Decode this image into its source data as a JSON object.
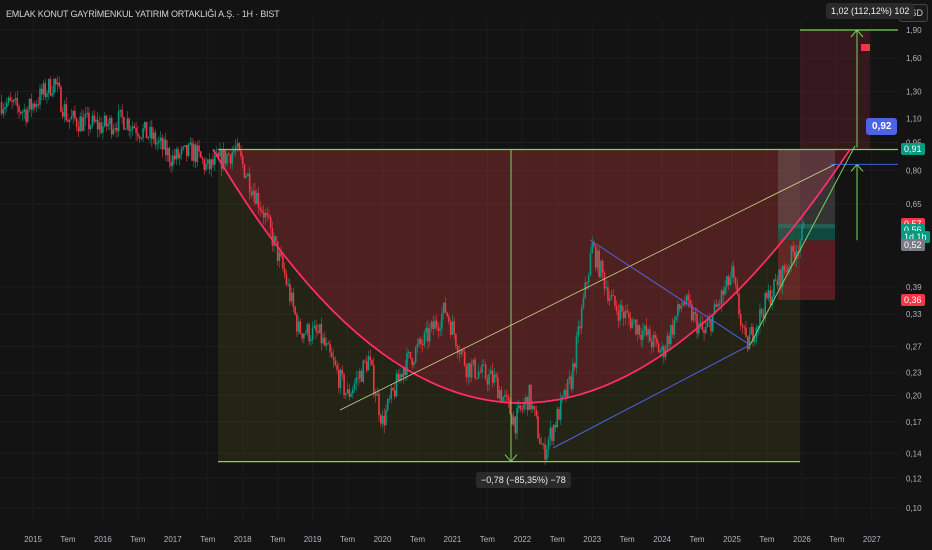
{
  "header": {
    "title": "EMLAK KONUT GAYRİMENKUL YATIRIM ORTAKLIĞI A.Ş. · 1H · BIST",
    "currency_button": "USD"
  },
  "annotations": {
    "measure_top": "1,02 (112,12%) 102",
    "measure_bottom": "−0,78 (−85,35%) −78",
    "target_callout": "0,92"
  },
  "price_labels": [
    {
      "text": "0,91",
      "color": "#089981",
      "price": 0.91
    },
    {
      "text": "0,57",
      "color": "#f23645",
      "price": 0.575
    },
    {
      "text": "0,56",
      "color": "#089981",
      "price": 0.555
    },
    {
      "text": "1d 1h",
      "color": "#089981",
      "price": 0.53
    },
    {
      "text": "0,52",
      "color": "#787b86",
      "price": 0.505
    },
    {
      "text": "0,36",
      "color": "#f23645",
      "price": 0.36
    }
  ],
  "chart_data": {
    "type": "candlestick",
    "title": "EMLAK KONUT GAYRİMENKUL YATIRIM ORTAKLIĞI A.Ş. · 1H · BIST",
    "yscale": "log",
    "ylim": [
      0.095,
      1.95
    ],
    "y_ticks": [
      "1,90",
      "1,60",
      "1,30",
      "1,10",
      "0,95",
      "0,80",
      "0,65",
      "0,39",
      "0,33",
      "0,27",
      "0,23",
      "0,20",
      "0,17",
      "0,14",
      "0,12",
      "0,10"
    ],
    "y_tick_values": [
      1.9,
      1.6,
      1.3,
      1.1,
      0.95,
      0.8,
      0.65,
      0.39,
      0.33,
      0.27,
      0.23,
      0.2,
      0.17,
      0.14,
      0.12,
      0.1
    ],
    "x_ticks": [
      "2015",
      "Tem",
      "2016",
      "Tem",
      "2017",
      "Tem",
      "2018",
      "Tem",
      "2019",
      "Tem",
      "2020",
      "Tem",
      "2021",
      "Tem",
      "2022",
      "Tem",
      "2023",
      "Tem",
      "2024",
      "Tem",
      "2025",
      "Tem",
      "2026",
      "Tem",
      "2027"
    ],
    "xlim": [
      2014.55,
      2027.5
    ],
    "price_path": [
      [
        2014.55,
        1.22
      ],
      [
        2014.9,
        1.15
      ],
      [
        2015.3,
        1.38
      ],
      [
        2015.5,
        1.1
      ],
      [
        2016.0,
        1.05
      ],
      [
        2016.3,
        1.1
      ],
      [
        2016.7,
        0.98
      ],
      [
        2017.0,
        0.86
      ],
      [
        2017.3,
        0.9
      ],
      [
        2017.5,
        0.81
      ],
      [
        2017.9,
        0.91
      ],
      [
        2018.3,
        0.62
      ],
      [
        2018.6,
        0.42
      ],
      [
        2018.8,
        0.3
      ],
      [
        2019.1,
        0.29
      ],
      [
        2019.5,
        0.2
      ],
      [
        2019.8,
        0.25
      ],
      [
        2020.0,
        0.17
      ],
      [
        2020.3,
        0.24
      ],
      [
        2020.6,
        0.28
      ],
      [
        2020.9,
        0.34
      ],
      [
        2021.2,
        0.24
      ],
      [
        2021.6,
        0.22
      ],
      [
        2021.9,
        0.17
      ],
      [
        2022.1,
        0.2
      ],
      [
        2022.3,
        0.14
      ],
      [
        2022.7,
        0.22
      ],
      [
        2023.0,
        0.5
      ],
      [
        2023.3,
        0.35
      ],
      [
        2023.7,
        0.3
      ],
      [
        2024.0,
        0.26
      ],
      [
        2024.3,
        0.36
      ],
      [
        2024.6,
        0.29
      ],
      [
        2025.0,
        0.42
      ],
      [
        2025.2,
        0.27
      ],
      [
        2025.5,
        0.36
      ],
      [
        2025.8,
        0.45
      ],
      [
        2026.05,
        0.56
      ]
    ],
    "colors": {
      "up": "#089981",
      "down": "#f23645"
    },
    "drawings": {
      "cup_rim": 0.91,
      "cup_bottom": 0.133,
      "target": 1.9,
      "current": 0.56
    }
  }
}
